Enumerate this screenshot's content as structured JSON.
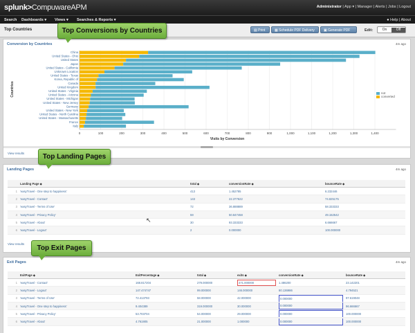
{
  "header": {
    "logo": "splunk>",
    "app_name": "CompuwareAPM",
    "user": "Administrator",
    "menu": [
      "App",
      "Manager",
      "Alerts",
      "Jobs",
      "Logout"
    ]
  },
  "nav": {
    "items": [
      "Search",
      "Dashboards ▾",
      "Views ▾",
      "Searches & Reports ▾"
    ],
    "help": "Help",
    "about": "About"
  },
  "toolbar": {
    "title": "Top Countries",
    "print": "Print",
    "schedule": "Schedule PDF Delivery",
    "generate": "Generate PDF",
    "edit_label": "Edit:",
    "toggle_on": "On",
    "toggle_off": "Off"
  },
  "callouts": {
    "countries": "Top Conversions by Countries",
    "landing": "Top Landing Pages",
    "exit": "Top Exit Pages"
  },
  "panels": {
    "countries": {
      "title": "Conversion by Countries",
      "ago": "4m ago",
      "view_results": "View results"
    },
    "landing": {
      "title": "Landing Pages",
      "ago": "4m ago",
      "view_results": "View results"
    },
    "exit": {
      "title": "Exit Pages",
      "ago": "4m ago"
    }
  },
  "chart_data": {
    "type": "bar",
    "orientation": "horizontal",
    "stacked": true,
    "xlabel": "Visits by Conversion",
    "ylabel": "Countries",
    "xlim": [
      0,
      1500
    ],
    "xticks": [
      0,
      100,
      200,
      300,
      400,
      500,
      600,
      700,
      800,
      900,
      1000,
      1100,
      1200,
      1300,
      1400
    ],
    "xtick_labels": [
      "0",
      "100",
      "200",
      "300",
      "400",
      "500",
      "600",
      "700",
      "800",
      "900",
      "1,000",
      "1,100",
      "1,200",
      "1,300",
      "1,400"
    ],
    "legend_position": "right",
    "categories": [
      "China",
      "United States - Ohio",
      "United States",
      "Japan",
      "United States - California",
      "Unknown Location",
      "United States - Texas",
      "Korea, Republic of",
      "Canada",
      "United Kingdom",
      "United States - Virginia",
      "United States - Arizona",
      "United States - Michigan",
      "United States - New Jersey",
      "Germany",
      "United States - New York",
      "United States - North Carolina",
      "United States - Massachusetts",
      "France",
      "Italy"
    ],
    "series": [
      {
        "name": "converted",
        "color": "#f5b800",
        "values": [
          325,
          283,
          220,
          207,
          166,
          118,
          90,
          83,
          76,
          76,
          62,
          54,
          50,
          48,
          43,
          36,
          33,
          30,
          26,
          20
        ]
      },
      {
        "name": "not",
        "color": "#5aafc9",
        "values": [
          1077,
          1044,
          1043,
          744,
          603,
          416,
          351,
          411,
          283,
          540,
          257,
          250,
          211,
          214,
          474,
          174,
          184,
          172,
          327,
          200
        ]
      }
    ]
  },
  "landing_table": {
    "columns": [
      "Landing Page ◆",
      "total ◆",
      "conversionRate ◆",
      "bounceRate ◆"
    ],
    "rows": [
      [
        "1",
        "'easyTravel - One step to happiness'",
        "413",
        "1.452785",
        "6.232446"
      ],
      [
        "2",
        "'easyTravel - Contact'",
        "143",
        "22.377622",
        "74.825175"
      ],
      [
        "3",
        "'easyTravel - Terms of Use'",
        "72",
        "36.888889",
        "58.333333"
      ],
      [
        "4",
        "'easyTravel - Privacy Policy'",
        "59",
        "50.847458",
        "49.152542"
      ],
      [
        "5",
        "'easyTravel - About'",
        "30",
        "93.333333",
        "6.666667"
      ],
      [
        "6",
        "'easyTravel - Logout'",
        "2",
        "0.000000",
        "100.000000"
      ]
    ]
  },
  "exit_table": {
    "columns": [
      "ExitPage ◆",
      "ExitPercentage ◆",
      "total ◆",
      "exits ◆",
      "conversionRate ◆",
      "bounceRate ◆"
    ],
    "rows": [
      [
        "1",
        "'easyTravel - Contact'",
        "168.817204",
        "279.000000",
        "471.000000",
        "1.486200",
        "23.142201"
      ],
      [
        "2",
        "'easyTravel - Logout'",
        "147.474747",
        "99.000000",
        "146.000000",
        "80.136986",
        "4.794521"
      ],
      [
        "3",
        "'easyTravel - Terms of Use'",
        "72.413793",
        "58.000000",
        "42.000000",
        "0.000000",
        "97.619048"
      ],
      [
        "4",
        "'easyTravel - One step to happiness'",
        "9.404389",
        "319.000000",
        "30.000000",
        "0.000000",
        "96.666667"
      ],
      [
        "5",
        "'easyTravel - Privacy Policy'",
        "53.703704",
        "54.000000",
        "29.000000",
        "0.000000",
        "100.000000"
      ],
      [
        "6",
        "'easyTravel - About'",
        "4.761905",
        "21.000000",
        "1.000000",
        "0.000000",
        "100.000000"
      ]
    ]
  }
}
